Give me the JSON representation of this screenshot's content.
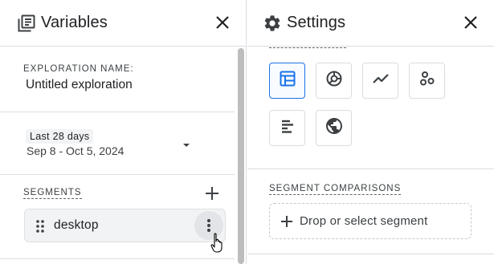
{
  "variables_panel": {
    "title": "Variables",
    "icon": "variables-list-icon",
    "close_icon": "close-icon",
    "exploration_name": {
      "label": "EXPLORATION NAME:",
      "value": "Untitled exploration"
    },
    "date_range": {
      "preset": "Last 28 days",
      "range": "Sep 8 - Oct 5, 2024",
      "caret_icon": "caret-down-icon"
    },
    "segments": {
      "label": "SEGMENTS",
      "add_icon": "plus-icon",
      "items": [
        {
          "name": "desktop",
          "drag_icon": "drag-handle-icon",
          "more_icon": "more-vert-icon"
        }
      ]
    }
  },
  "settings_panel": {
    "title": "Settings",
    "icon": "gear-icon",
    "close_icon": "close-icon",
    "visualizations": [
      {
        "icon": "table-icon",
        "active": true
      },
      {
        "icon": "donut-chart-icon",
        "active": false
      },
      {
        "icon": "line-chart-icon",
        "active": false
      },
      {
        "icon": "scatter-plot-icon",
        "active": false
      },
      {
        "icon": "bar-chart-icon",
        "active": false
      },
      {
        "icon": "globe-icon",
        "active": false
      }
    ],
    "segment_comparisons": {
      "label": "SEGMENT COMPARISONS",
      "drop_text": "Drop or select segment",
      "plus_icon": "plus-icon"
    }
  },
  "colors": {
    "accent": "#1a73e8",
    "icon": "#3c4043",
    "chip_bg": "#f1f3f4",
    "border": "#dadce0"
  }
}
